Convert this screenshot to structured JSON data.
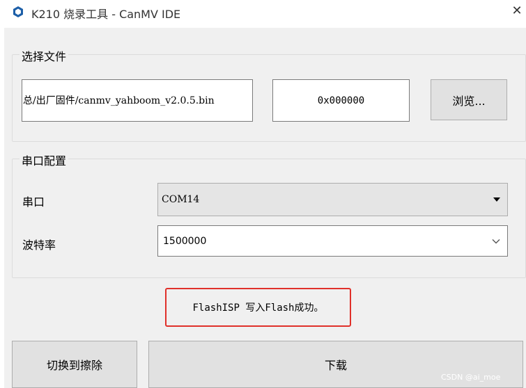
{
  "window": {
    "title": "K210 烧录工具 - CanMV IDE",
    "close_glyph": "✕"
  },
  "file_group": {
    "title": "选择文件",
    "file_path": "总/出厂固件/canmv_yahboom_v2.0.5.bin",
    "address": "0x000000",
    "browse_label": "浏览..."
  },
  "serial_group": {
    "title": "串口配置",
    "port_label": "串口",
    "port_value": "COM14",
    "baud_label": "波特率",
    "baud_value": "1500000"
  },
  "status": {
    "message": "FlashISP 写入Flash成功。",
    "highlight_color": "#e0302a"
  },
  "buttons": {
    "switch_erase": "切换到擦除",
    "download": "下载"
  },
  "watermark": "CSDN @ai_moe",
  "icons": {
    "app": "canmv-hexagon-icon",
    "close": "close-icon",
    "dropdown": "chevron-down-icon"
  }
}
